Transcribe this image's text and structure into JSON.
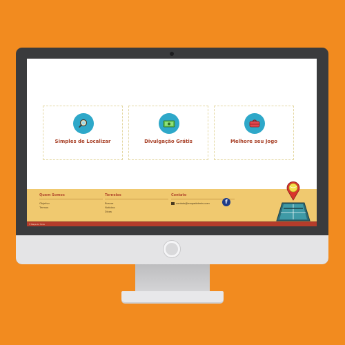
{
  "features": [
    {
      "label": "Simples de Localizar",
      "icon": "magnifier-icon"
    },
    {
      "label": "Divulgação Grátis",
      "icon": "money-icon"
    },
    {
      "label": "Melhore seu Jogo",
      "icon": "bag-icon"
    }
  ],
  "footer": {
    "quem_somos": {
      "heading": "Quem Somos",
      "links": [
        "Objetivo",
        "Termos"
      ]
    },
    "torneios": {
      "heading": "Torneios",
      "links": [
        "Buscar",
        "Notícias",
        "Dicas"
      ]
    },
    "contato": {
      "heading": "Contato",
      "email": "contato@mapadotenis.com"
    },
    "facebook_label": "f",
    "copyright": "© Mapa do Tênis"
  },
  "colors": {
    "background": "#f28b1f",
    "accent": "#2ea8c9",
    "footer": "#f0c96f",
    "footer_bar": "#b43c2b",
    "card_text": "#a9432a"
  }
}
